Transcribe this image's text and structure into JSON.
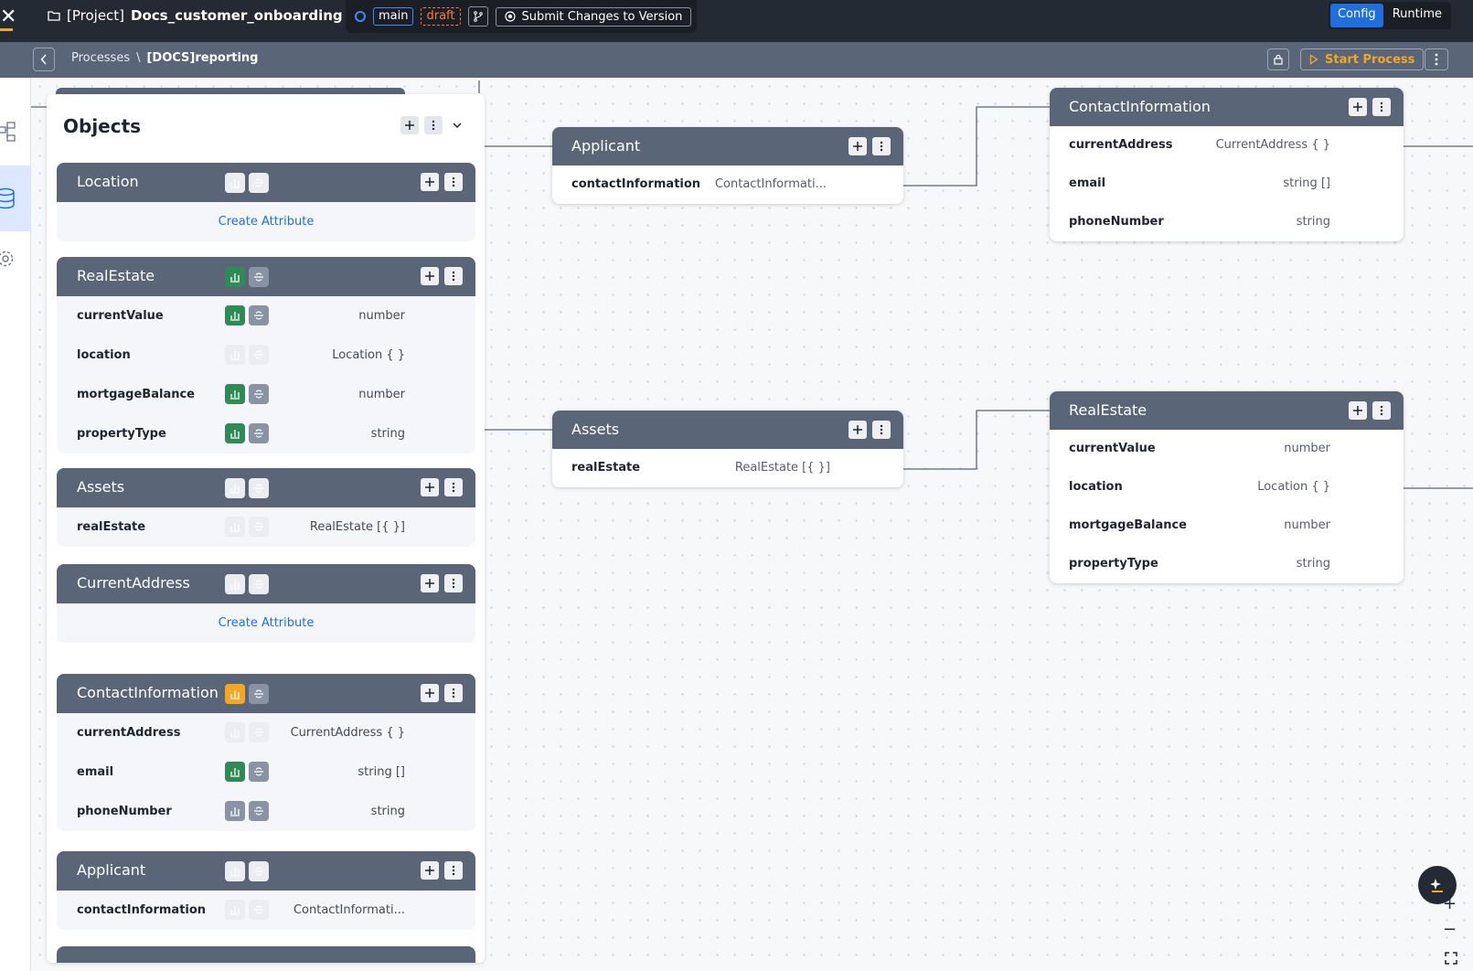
{
  "header": {
    "project_prefix": "[Project]",
    "project_name": "Docs_customer_onboarding",
    "branch": "main",
    "status": "draft",
    "submit_label": "Submit Changes to Version",
    "modes": [
      "Config",
      "Runtime"
    ]
  },
  "subheader": {
    "crumb_root": "Processes",
    "separator": "\\",
    "crumb_current": "[DOCS]reporting",
    "start_label": "Start Process"
  },
  "panel": {
    "title": "Objects",
    "create_label": "Create Attribute",
    "objects": [
      {
        "name": "Location",
        "attrs": []
      },
      {
        "name": "RealEstate",
        "attrs": [
          {
            "name": "currentValue",
            "type": "number"
          },
          {
            "name": "location",
            "type": "Location { }"
          },
          {
            "name": "mortgageBalance",
            "type": "number"
          },
          {
            "name": "propertyType",
            "type": "string"
          }
        ]
      },
      {
        "name": "Assets",
        "attrs": [
          {
            "name": "realEstate",
            "type": "RealEstate [{ }]"
          }
        ]
      },
      {
        "name": "CurrentAddress",
        "attrs": []
      },
      {
        "name": "ContactInformation",
        "attrs": [
          {
            "name": "currentAddress",
            "type": "CurrentAddress { }"
          },
          {
            "name": "email",
            "type": "string []"
          },
          {
            "name": "phoneNumber",
            "type": "string"
          }
        ]
      },
      {
        "name": "Applicant",
        "attrs": [
          {
            "name": "contactInformation",
            "type": "ContactInformati..."
          }
        ]
      }
    ]
  },
  "canvas": {
    "nodes": [
      {
        "name": "Applicant",
        "attrs": [
          {
            "name": "contactInformation",
            "type": "ContactInformati..."
          }
        ]
      },
      {
        "name": "ContactInformation",
        "attrs": [
          {
            "name": "currentAddress",
            "type": "CurrentAddress { }"
          },
          {
            "name": "email",
            "type": "string []"
          },
          {
            "name": "phoneNumber",
            "type": "string"
          }
        ]
      },
      {
        "name": "Assets",
        "attrs": [
          {
            "name": "realEstate",
            "type": "RealEstate [{ }]"
          }
        ]
      },
      {
        "name": "RealEstate",
        "attrs": [
          {
            "name": "currentValue",
            "type": "number"
          },
          {
            "name": "location",
            "type": "Location { }"
          },
          {
            "name": "mortgageBalance",
            "type": "number"
          },
          {
            "name": "propertyType",
            "type": "string"
          }
        ]
      }
    ]
  },
  "zoom": {
    "in": "+",
    "out": "−"
  },
  "colors": {
    "accent": "#1f6fe0",
    "warning": "#f5a623",
    "draft": "#ff7a45",
    "enabled": "#2e8b57"
  }
}
